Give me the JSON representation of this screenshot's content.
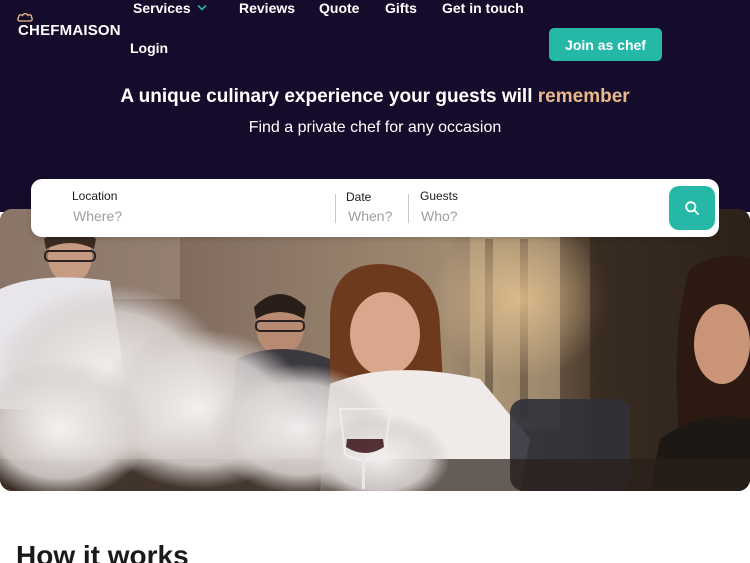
{
  "brand": {
    "name": "CHEFMAISON",
    "icon": "chef-hat-icon"
  },
  "nav": {
    "services": "Services",
    "reviews": "Reviews",
    "quote": "Quote",
    "gifts": "Gifts",
    "contact": "Get in touch",
    "login": "Login",
    "join": "Join as chef"
  },
  "hero": {
    "headline_start": "A unique culinary experience your guests will",
    "headline_accent": "remember",
    "subheadline": "Find a private chef for any occasion"
  },
  "search": {
    "location_label": "Location",
    "location_placeholder": "Where?",
    "date_label": "Date",
    "date_placeholder": "When?",
    "guests_label": "Guests",
    "guests_placeholder": "Who?",
    "button_icon": "search-icon"
  },
  "section": {
    "title": "How it works"
  },
  "colors": {
    "navy": "#150c2b",
    "teal": "#26b8a6",
    "accent": "#e9b98a"
  }
}
